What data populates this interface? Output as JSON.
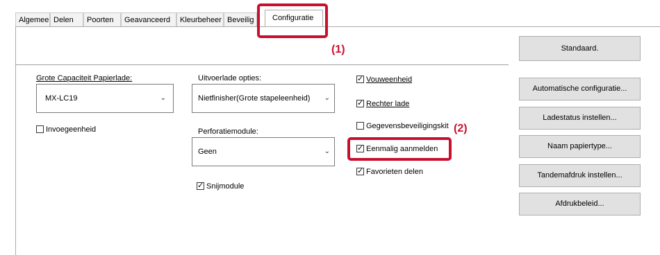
{
  "tabs": [
    {
      "label": "Algemeen"
    },
    {
      "label": "Delen"
    },
    {
      "label": "Poorten"
    },
    {
      "label": "Geavanceerd"
    },
    {
      "label": "Kleurbeheer"
    },
    {
      "label": "Beveilig"
    },
    {
      "label": "Configuratie"
    }
  ],
  "callouts": {
    "one": "(1)",
    "two": "(2)"
  },
  "colors": {
    "highlight": "#c8102e",
    "button_bg": "#e1e1e1"
  },
  "left": {
    "grote_label": "Grote Capaciteit Papierlade:",
    "grote_value": "MX-LC19",
    "invoer_label": "Invoegeenheid"
  },
  "middle": {
    "uitvoer_label": "Uitvoerlade opties:",
    "uitvoer_value": "Nietfinisher(Grote stapeleenheid)",
    "perforatie_label": "Perforatiemodule:",
    "perforatie_value": "Geen",
    "snij_label": "Snijmodule"
  },
  "right_checks": [
    {
      "label": "Vouweenheid",
      "checked": true
    },
    {
      "label": "Rechter lade",
      "checked": true
    },
    {
      "label": "Gegevensbeveiligingskit",
      "checked": false
    },
    {
      "label": "Eenmalig aanmelden",
      "checked": true
    },
    {
      "label": "Favorieten delen",
      "checked": true
    }
  ],
  "left_checks": {
    "invoer_checked": false,
    "snij_checked": true
  },
  "buttons": {
    "standaard": "Standaard.",
    "auto": "Automatische configuratie...",
    "ladestatus": "Ladestatus instellen...",
    "naam": "Naam papiertype...",
    "tandem": "Tandemafdruk instellen...",
    "afdruk": "Afdrukbeleid..."
  }
}
